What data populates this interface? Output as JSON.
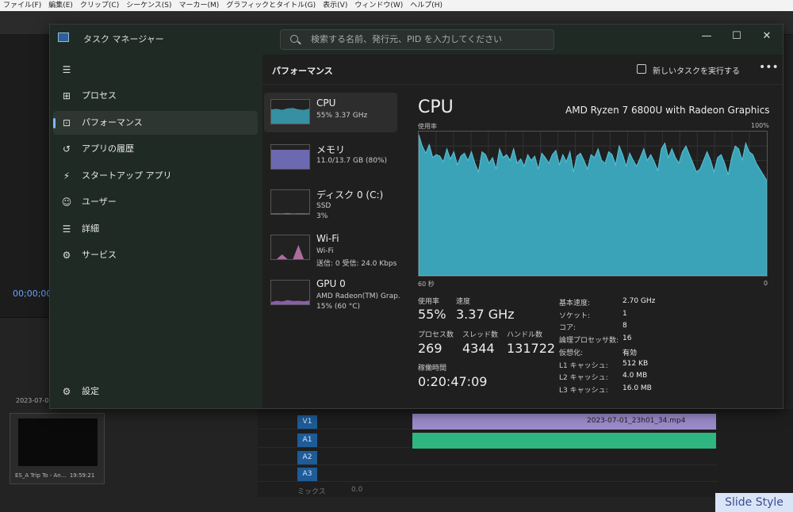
{
  "premiere": {
    "menu": [
      "ファイル(F)",
      "編集(E)",
      "クリップ(C)",
      "シーケンス(S)",
      "マーカー(M)",
      "グラフィックとタイトル(G)",
      "表示(V)",
      "ウィンドウ(W)",
      "ヘルプ(H)"
    ],
    "timecode": "00;00;00",
    "thumb_name": "ES_A Trip To - An...",
    "thumb_duration": "19:59:21",
    "thumb_date": "2023-07-0",
    "clip_name": "2023-07-01_23h01_34.mp4",
    "tracks": [
      "V1",
      "A1",
      "A2",
      "A3"
    ],
    "mix_label": "ミックス",
    "mix_value": "0.0",
    "watermark": "Slide Style"
  },
  "taskmanager": {
    "title": "タスク マネージャー",
    "search_placeholder": "検索する名前、発行元、PID を入力してください",
    "nav": [
      {
        "label": "プロセス",
        "icon": "processes-icon",
        "glyph": "⊞"
      },
      {
        "label": "パフォーマンス",
        "icon": "performance-icon",
        "glyph": "⊡"
      },
      {
        "label": "アプリの履歴",
        "icon": "app-history-icon",
        "glyph": "↺"
      },
      {
        "label": "スタートアップ アプリ",
        "icon": "startup-icon",
        "glyph": "⚡"
      },
      {
        "label": "ユーザー",
        "icon": "users-icon",
        "glyph": "☺"
      },
      {
        "label": "詳細",
        "icon": "details-icon",
        "glyph": "☰"
      },
      {
        "label": "サービス",
        "icon": "services-icon",
        "glyph": "⚙"
      }
    ],
    "settings_label": "設定",
    "section_title": "パフォーマンス",
    "new_task_label": "新しいタスクを実行する",
    "devices": [
      {
        "name": "CPU",
        "sub1": "55% 3.37 GHz",
        "sub2": "",
        "color": "#3aa3b8"
      },
      {
        "name": "メモリ",
        "sub1": "11.0/13.7 GB (80%)",
        "sub2": "",
        "color": "#7a76c9"
      },
      {
        "name": "ディスク 0 (C:)",
        "sub1": "SSD",
        "sub2": "3%",
        "color": "#4aa88a"
      },
      {
        "name": "Wi-Fi",
        "sub1": "Wi-Fi",
        "sub2": "送信: 0 受信: 24.0 Kbps",
        "color": "#c37bb2"
      },
      {
        "name": "GPU 0",
        "sub1": "AMD Radeon(TM) Grap.",
        "sub2": "15% (60 °C)",
        "color": "#9b6ac0"
      }
    ],
    "cpu": {
      "title": "CPU",
      "model": "AMD Ryzen 7 6800U with Radeon Graphics",
      "usage_label": "使用率",
      "max_label": "100%",
      "time_label": "60 秒",
      "zero_label": "0",
      "graph_color": "#3aa3b8",
      "stats": {
        "usage_lbl": "使用率",
        "usage": "55%",
        "speed_lbl": "速度",
        "speed": "3.37 GHz",
        "proc_lbl": "プロセス数",
        "proc": "269",
        "thread_lbl": "スレッド数",
        "thread": "4344",
        "handle_lbl": "ハンドル数",
        "handle": "131722",
        "uptime_lbl": "稼働時間",
        "uptime": "0:20:47:09"
      },
      "right": [
        {
          "label": "基本速度:",
          "value": "2.70 GHz"
        },
        {
          "label": "ソケット:",
          "value": "1"
        },
        {
          "label": "コア:",
          "value": "8"
        },
        {
          "label": "論理プロセッサ数:",
          "value": "16"
        },
        {
          "label": "仮想化:",
          "value": "有効"
        },
        {
          "label": "L1 キャッシュ:",
          "value": "512 KB"
        },
        {
          "label": "L2 キャッシュ:",
          "value": "4.0 MB"
        },
        {
          "label": "L3 キャッシュ:",
          "value": "16.0 MB"
        }
      ]
    }
  },
  "chart_data": {
    "type": "area",
    "values": [
      98,
      90,
      85,
      91,
      82,
      84,
      83,
      79,
      88,
      81,
      86,
      77,
      83,
      85,
      80,
      86,
      78,
      72,
      86,
      84,
      78,
      82,
      74,
      88,
      82,
      84,
      80,
      88,
      78,
      81,
      76,
      84,
      80,
      83,
      74,
      85,
      82,
      78,
      84,
      87,
      77,
      84,
      79,
      86,
      72,
      83,
      85,
      80,
      74,
      84,
      82,
      88,
      80,
      78,
      86,
      84,
      77,
      90,
      84,
      76,
      85,
      80,
      76,
      82,
      88,
      80,
      84,
      79,
      73,
      88,
      92,
      82,
      88,
      82,
      78,
      86,
      90,
      84,
      78,
      72,
      74,
      80,
      86,
      80,
      72,
      82,
      84,
      78,
      70,
      82,
      90,
      88,
      80,
      92,
      86,
      84,
      78,
      74,
      70,
      66
    ],
    "ylim": [
      0,
      100
    ]
  }
}
